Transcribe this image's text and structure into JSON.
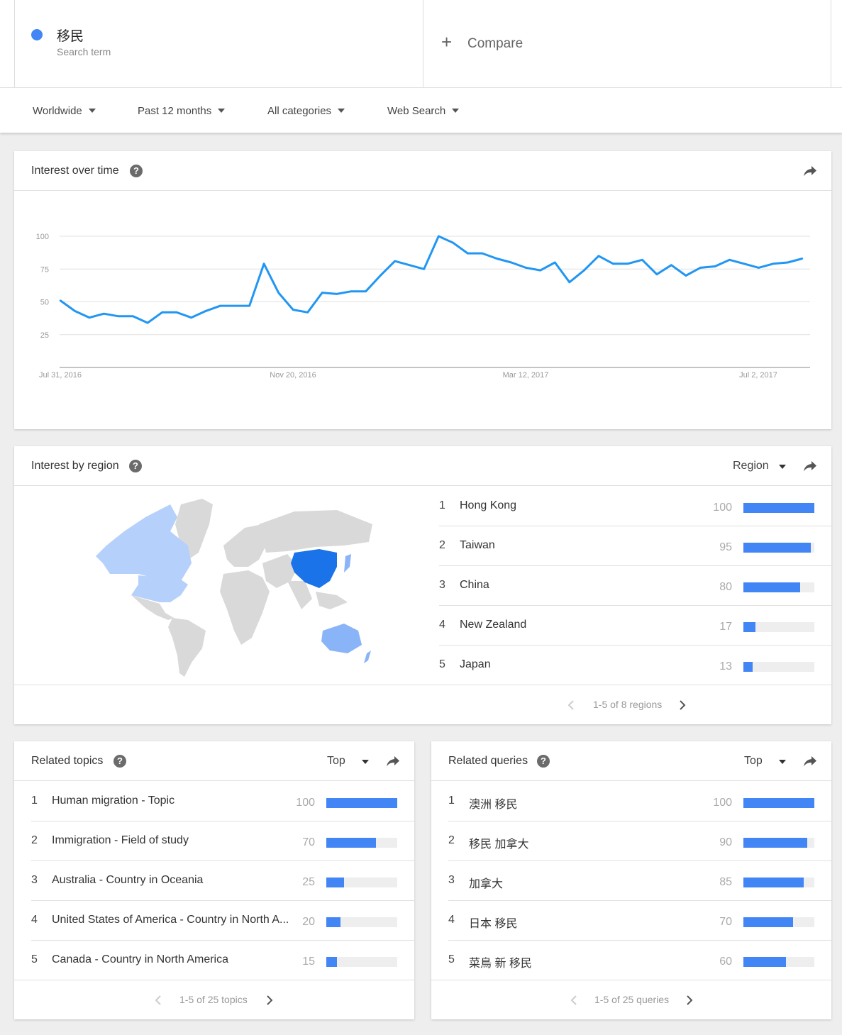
{
  "search_term": {
    "text": "移民",
    "sub": "Search term",
    "color": "#4285f4"
  },
  "compare": {
    "plus": "+",
    "label": "Compare"
  },
  "filters": [
    {
      "label": "Worldwide"
    },
    {
      "label": "Past 12 months"
    },
    {
      "label": "All categories"
    },
    {
      "label": "Web Search"
    }
  ],
  "interest_over_time": {
    "title": "Interest over time",
    "help": "?",
    "chart_data": {
      "type": "line",
      "title": "",
      "xlabel": "",
      "ylabel": "",
      "ylim": [
        0,
        100
      ],
      "y_ticks": [
        "100",
        "75",
        "50",
        "25"
      ],
      "x_ticks": [
        "Jul 31, 2016",
        "Nov 20, 2016",
        "Mar 12, 2017",
        "Jul 2, 2017"
      ],
      "series": [
        {
          "color": "#2196f3",
          "values": [
            51,
            43,
            38,
            41,
            39,
            39,
            34,
            42,
            42,
            38,
            43,
            47,
            47,
            47,
            79,
            57,
            44,
            42,
            57,
            56,
            58,
            58,
            70,
            81,
            78,
            75,
            100,
            95,
            87,
            87,
            83,
            80,
            76,
            74,
            80,
            65,
            74,
            85,
            79,
            79,
            82,
            71,
            78,
            70,
            76,
            77,
            82,
            79,
            76,
            79,
            80,
            83
          ]
        }
      ]
    }
  },
  "interest_by_region": {
    "title": "Interest by region",
    "help": "?",
    "dropdown": "Region",
    "rows": [
      {
        "rank": "1",
        "name": "Hong Kong",
        "value": 100
      },
      {
        "rank": "2",
        "name": "Taiwan",
        "value": 95
      },
      {
        "rank": "3",
        "name": "China",
        "value": 80
      },
      {
        "rank": "4",
        "name": "New Zealand",
        "value": 17
      },
      {
        "rank": "5",
        "name": "Japan",
        "value": 13
      }
    ],
    "pager": "1-5 of 8 regions",
    "map_colors": {
      "high": "#1a73e8",
      "mid": "#8ab4f8",
      "low": "#b5d0fb",
      "none": "#d9d9d9"
    }
  },
  "related_topics": {
    "title": "Related topics",
    "help": "?",
    "dropdown": "Top",
    "rows": [
      {
        "rank": "1",
        "name": "Human migration - Topic",
        "value": 100
      },
      {
        "rank": "2",
        "name": "Immigration - Field of study",
        "value": 70
      },
      {
        "rank": "3",
        "name": "Australia - Country in Oceania",
        "value": 25
      },
      {
        "rank": "4",
        "name": "United States of America - Country in North A...",
        "value": 20
      },
      {
        "rank": "5",
        "name": "Canada - Country in North America",
        "value": 15
      }
    ],
    "pager": "1-5 of 25 topics"
  },
  "related_queries": {
    "title": "Related queries",
    "help": "?",
    "dropdown": "Top",
    "rows": [
      {
        "rank": "1",
        "name": "澳洲 移民",
        "value": 100
      },
      {
        "rank": "2",
        "name": "移民 加拿大",
        "value": 90
      },
      {
        "rank": "3",
        "name": "加拿大",
        "value": 85
      },
      {
        "rank": "4",
        "name": "日本 移民",
        "value": 70
      },
      {
        "rank": "5",
        "name": "菜鳥 新 移民",
        "value": 60
      }
    ],
    "pager": "1-5 of 25 queries"
  },
  "icons": {
    "share": "share-arrow-icon",
    "help": "help-circle-icon",
    "prev": "chevron-left-icon",
    "next": "chevron-right-icon"
  }
}
